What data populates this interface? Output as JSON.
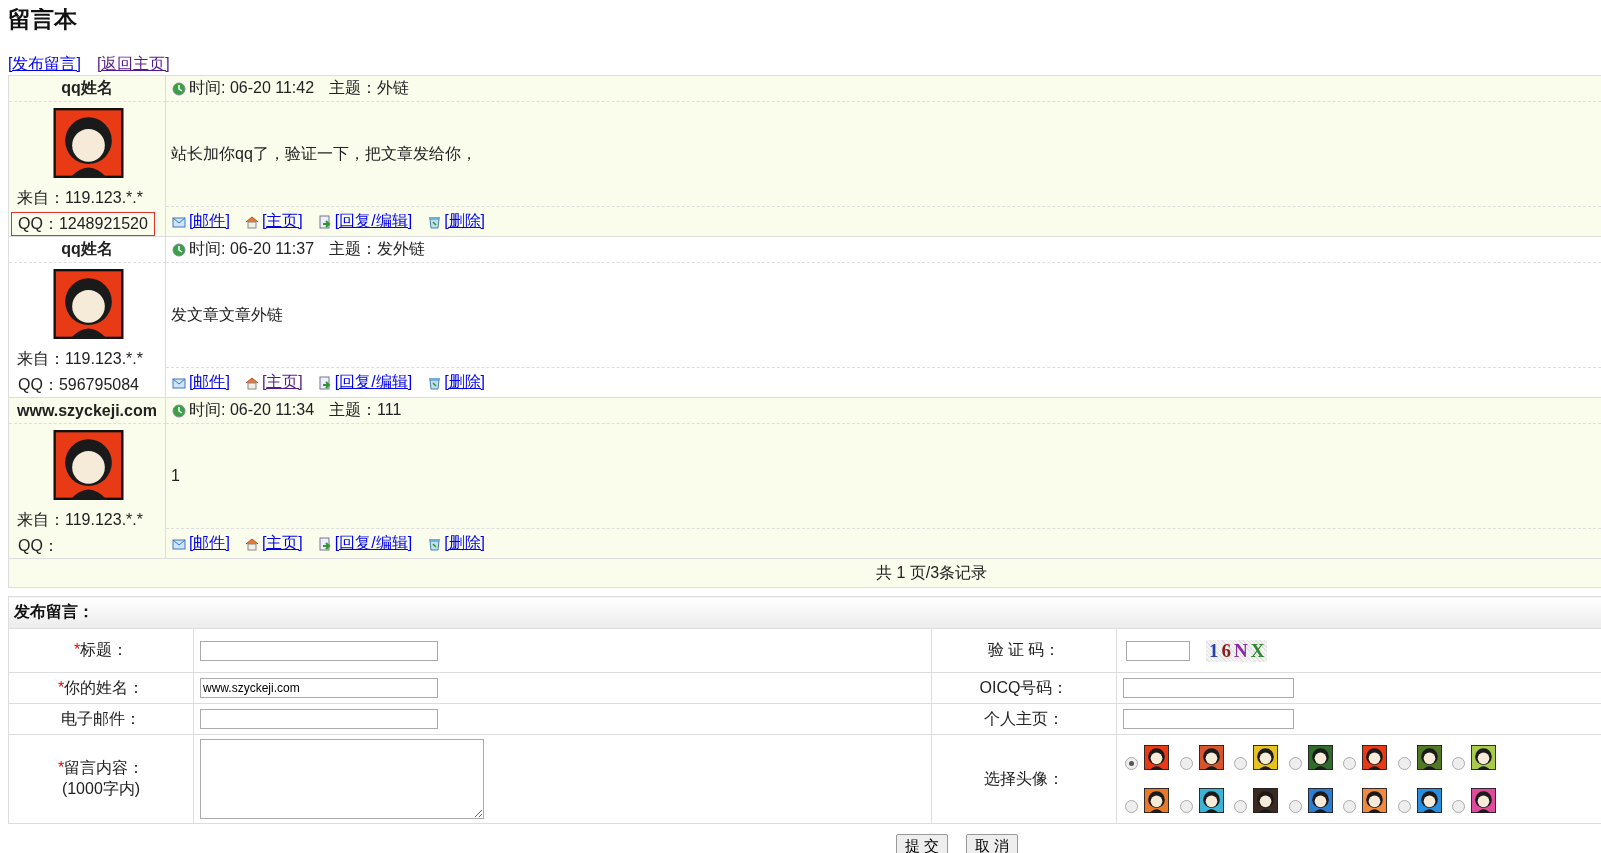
{
  "title": "留言本",
  "top_links": [
    {
      "label": "[发布留言]",
      "visited": false
    },
    {
      "label": "[返回主页]",
      "visited": true
    }
  ],
  "posts": [
    {
      "name": "qq姓名",
      "time": "时间: 06-20 11:42",
      "subject": "主题：外链",
      "message": "站长加你qq了，验证一下，把文章发给你，",
      "from": "来自：119.123.*.*",
      "qq": "QQ：1248921520",
      "highlighted": true,
      "shaded": true,
      "actions": [
        {
          "kind": "mail",
          "label": "[邮件]",
          "visited": false
        },
        {
          "kind": "home",
          "label": "[主页]",
          "visited": false
        },
        {
          "kind": "reply",
          "label": "[回复/编辑]",
          "visited": false
        },
        {
          "kind": "delete",
          "label": "[删除]",
          "visited": false
        }
      ]
    },
    {
      "name": "qq姓名",
      "time": "时间: 06-20 11:37",
      "subject": "主题：发外链",
      "message": "发文章文章外链",
      "from": "来自：119.123.*.*",
      "qq": "QQ：596795084",
      "highlighted": false,
      "shaded": false,
      "actions": [
        {
          "kind": "mail",
          "label": "[邮件]",
          "visited": false
        },
        {
          "kind": "home",
          "label": "[主页]",
          "visited": true
        },
        {
          "kind": "reply",
          "label": "[回复/编辑]",
          "visited": false
        },
        {
          "kind": "delete",
          "label": "[删除]",
          "visited": false
        }
      ]
    },
    {
      "name": "www.szyckeji.com",
      "time": "时间: 06-20 11:34",
      "subject": "主题：111",
      "message": "1",
      "from": "来自：119.123.*.*",
      "qq": "QQ：",
      "highlighted": false,
      "shaded": true,
      "actions": [
        {
          "kind": "mail",
          "label": "[邮件]",
          "visited": false
        },
        {
          "kind": "home",
          "label": "[主页]",
          "visited": false
        },
        {
          "kind": "reply",
          "label": "[回复/编辑]",
          "visited": false
        },
        {
          "kind": "delete",
          "label": "[删除]",
          "visited": false
        }
      ]
    }
  ],
  "pagination": "共 1 页/3条记录",
  "form": {
    "heading": "发布留言：",
    "rows": [
      {
        "left": {
          "label": "标题：",
          "required_mark": "*",
          "kind": "input"
        },
        "right": {
          "label": "验 证 码：",
          "kind": "captcha",
          "captcha": [
            {
              "char": "1",
              "color": "#2a3fae"
            },
            {
              "char": "6",
              "color": "#8b1c1c"
            },
            {
              "char": "N",
              "color": "#8a2aa6"
            },
            {
              "char": "X",
              "color": "#2e8a2e"
            }
          ]
        }
      },
      {
        "left": {
          "label": "你的姓名：",
          "required_mark": "*",
          "kind": "input",
          "value": "www.szyckeji.com"
        },
        "right": {
          "label": "OICQ号码：",
          "kind": "input"
        }
      },
      {
        "left": {
          "label": "电子邮件：",
          "kind": "input"
        },
        "right": {
          "label": "个人主页：",
          "kind": "input"
        }
      },
      {
        "left": {
          "label": "留言内容：",
          "note": "(1000字内)",
          "required_mark": "*",
          "kind": "textarea"
        },
        "right": {
          "label": "选择头像：",
          "kind": "avatars",
          "avatars": [
            {
              "color": "#e83a14",
              "selected": true
            },
            {
              "color": "#d9532b",
              "selected": false
            },
            {
              "color": "#e8c21e",
              "selected": false
            },
            {
              "color": "#2f6b2a",
              "selected": false
            },
            {
              "color": "#e83a14",
              "selected": false
            },
            {
              "color": "#4f7a23",
              "selected": false
            },
            {
              "color": "#a8cc4a",
              "selected": false
            },
            {
              "color": "#e8792a",
              "selected": false
            },
            {
              "color": "#3cb4d6",
              "selected": false
            },
            {
              "color": "#3a2a20",
              "selected": false
            },
            {
              "color": "#2c7cd0",
              "selected": false
            },
            {
              "color": "#f08a40",
              "selected": false
            },
            {
              "color": "#2a8ee0",
              "selected": false
            },
            {
              "color": "#e04a9c",
              "selected": false
            }
          ]
        }
      }
    ],
    "buttons": [
      "提 交",
      "取 消"
    ]
  }
}
